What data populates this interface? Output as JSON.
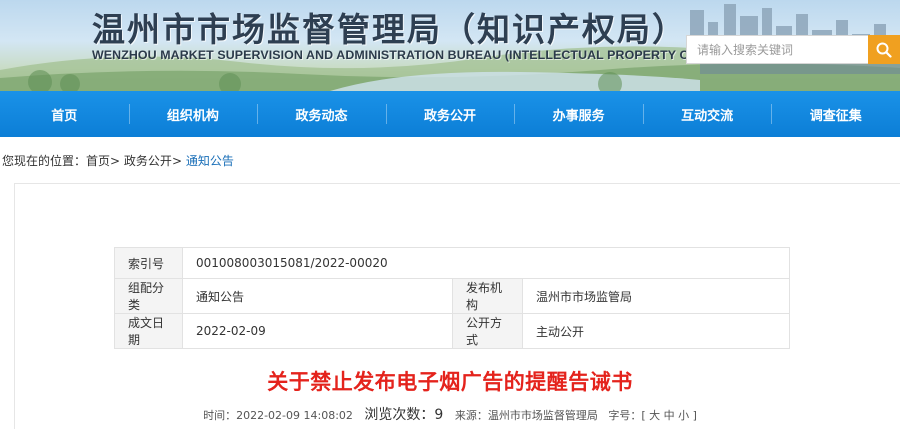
{
  "header": {
    "title": "温州市市场监督管理局（知识产权局）",
    "subtitle": "WENZHOU MARKET SUPERVISION AND ADMINISTRATION BUREAU (INTELLECTUAL PROPERTY OFFICE)",
    "search_placeholder": "请输入搜索关键词",
    "search_icon": "search-icon",
    "accent_color": "#f0a020"
  },
  "nav": {
    "color": "#0c7ed6",
    "items": [
      "首页",
      "组织机构",
      "政务动态",
      "政务公开",
      "办事服务",
      "互动交流",
      "调查征集"
    ]
  },
  "breadcrumb": {
    "prefix": "您现在的位置：",
    "items": [
      "首页",
      "政务公开",
      "通知公告"
    ],
    "separator": ">"
  },
  "meta": {
    "index_label": "索引号",
    "index_value": "001008003015081/2022-00020",
    "category_label": "组配分类",
    "category_value": "通知公告",
    "publisher_label": "发布机构",
    "publisher_value": "温州市市场监管局",
    "date_label": "成文日期",
    "date_value": "2022-02-09",
    "disclosure_label": "公开方式",
    "disclosure_value": "主动公开"
  },
  "article": {
    "title": "关于禁止发布电子烟广告的提醒告诫书",
    "title_color": "#e4231c",
    "time_label": "时间：",
    "time_value": "2022-02-09 14:08:02",
    "views_label": "浏览次数：",
    "views_value": "9",
    "source_label": "来源：",
    "source_value": "温州市市场监督管理局",
    "fontsize_label": "字号：",
    "fontsize_open": "[",
    "fontsize_large": "大",
    "fontsize_medium": "中",
    "fontsize_small": "小",
    "fontsize_close": "]"
  }
}
